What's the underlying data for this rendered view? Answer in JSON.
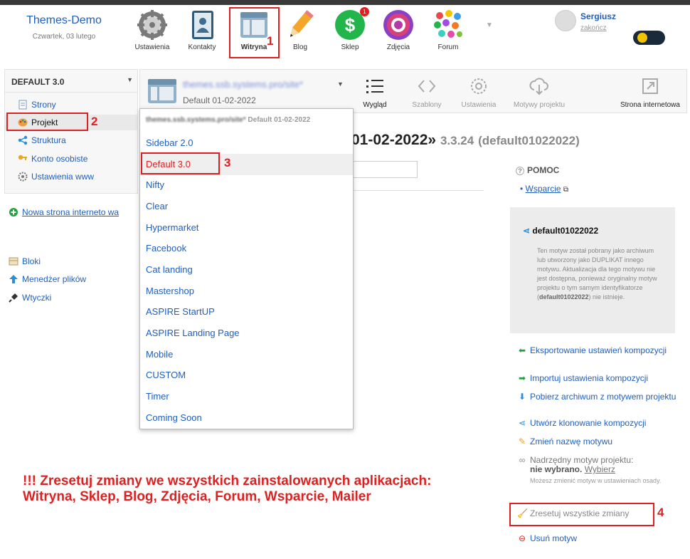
{
  "header": {
    "site_name": "Themes-Demo",
    "date": "Czwartek, 03 lutego",
    "apps": [
      {
        "label": "Ustawienia",
        "icon": "gear-icon"
      },
      {
        "label": "Kontakty",
        "icon": "contacts-book-icon"
      },
      {
        "label": "Witryna",
        "icon": "website-icon"
      },
      {
        "label": "Blog",
        "icon": "pencil-icon"
      },
      {
        "label": "Sklep",
        "icon": "dollar-icon",
        "badge": "1"
      },
      {
        "label": "Zdjęcia",
        "icon": "camera-lens-icon"
      },
      {
        "label": "Forum",
        "icon": "forum-icon"
      }
    ],
    "user": {
      "name": "Sergiusz",
      "logout": "zakończ"
    }
  },
  "sidebar": {
    "title": "DEFAULT 3.0",
    "items": [
      {
        "label": "Strony",
        "icon": "page-icon"
      },
      {
        "label": "Projekt",
        "icon": "palette-icon"
      },
      {
        "label": "Struktura",
        "icon": "share-icon"
      },
      {
        "label": "Konto osobiste",
        "icon": "key-icon"
      },
      {
        "label": "Ustawienia www",
        "icon": "gear-icon"
      }
    ],
    "new_site": "Nowa strona interneto wa",
    "links": [
      {
        "label": "Bloki",
        "icon": "blocks-icon"
      },
      {
        "label": "Menedżer plików",
        "icon": "upload-arrow-icon"
      },
      {
        "label": "Wtyczki",
        "icon": "plug-icon"
      }
    ]
  },
  "toolbar": {
    "site_url": "themes.ssb.systems.pro/site*",
    "theme_date": "Default 01-02-2022",
    "buttons": [
      {
        "label": "Wygląd",
        "icon": "list-icon",
        "active": true
      },
      {
        "label": "Szablony",
        "icon": "code-icon",
        "active": false
      },
      {
        "label": "Ustawienia",
        "icon": "gear-icon",
        "active": false
      },
      {
        "label": "Motywy projektu",
        "icon": "cloud-download-icon",
        "active": false
      },
      {
        "label": "Strona internetowa",
        "icon": "external-link-icon",
        "active": true
      }
    ]
  },
  "dropdown": {
    "current_url": "themes.ssb.systems.pro/site*",
    "current_date": "Default 01-02-2022",
    "items": [
      "Sidebar 2.0",
      "Default 3.0",
      "Nifty",
      "Clear",
      "Hypermarket",
      "Facebook",
      "Cat landing",
      "Mastershop",
      "ASPIRE StartUP",
      "ASPIRE Landing Page",
      "Mobile",
      "CUSTOM",
      "Timer",
      "Coming Soon"
    ]
  },
  "main": {
    "heading": "01-02-2022»",
    "version": "3.3.24",
    "theme_id": "(default01022022)"
  },
  "help": {
    "title": "POMOC",
    "support": "Wsparcie"
  },
  "infobox": {
    "title": "default01022022",
    "desc_1": "Ten motyw został pobrany jako archiwum lub utworzony jako DUPLIKAT innego motywu. Aktualizacja dla tego motywu nie jest dostępna, ponieważ oryginalny motyw projektu o tym samym identyfikatorze (",
    "desc_id": "default01022022",
    "desc_2": ") nie istnieje."
  },
  "actions": {
    "export": "Eksportowanie ustawień kompozycji",
    "import": "Importuj ustawienia kompozycji",
    "download": "Pobierz archiwum z motywem projektu",
    "clone": "Utwórz klonowanie kompozycji",
    "rename": "Zmień nazwę motywu",
    "parent_label": "Nadrzędny motyw projektu:",
    "parent_value": "nie wybrano.",
    "parent_choose": "Wybierz",
    "parent_hint": "Możesz zmienić motyw w ustawieniach osady.",
    "reset": "Zresetuj wszystkie zmiany",
    "delete": "Usuń motyw"
  },
  "annotations": {
    "n1": "1",
    "n2": "2",
    "n3": "3",
    "n4": "4",
    "warning_line1": "!!! Zresetuj zmiany we wszystkich zainstalowanych aplikacjach:",
    "warning_line2": "Witryna, Sklep, Blog, Zdjęcia, Forum, Wsparcie, Mailer"
  },
  "colors": {
    "link": "#1f5fbf",
    "annotation_red": "#e02020",
    "toggle_bg": "#1a2a3a",
    "toggle_knob": "#f5c400"
  }
}
